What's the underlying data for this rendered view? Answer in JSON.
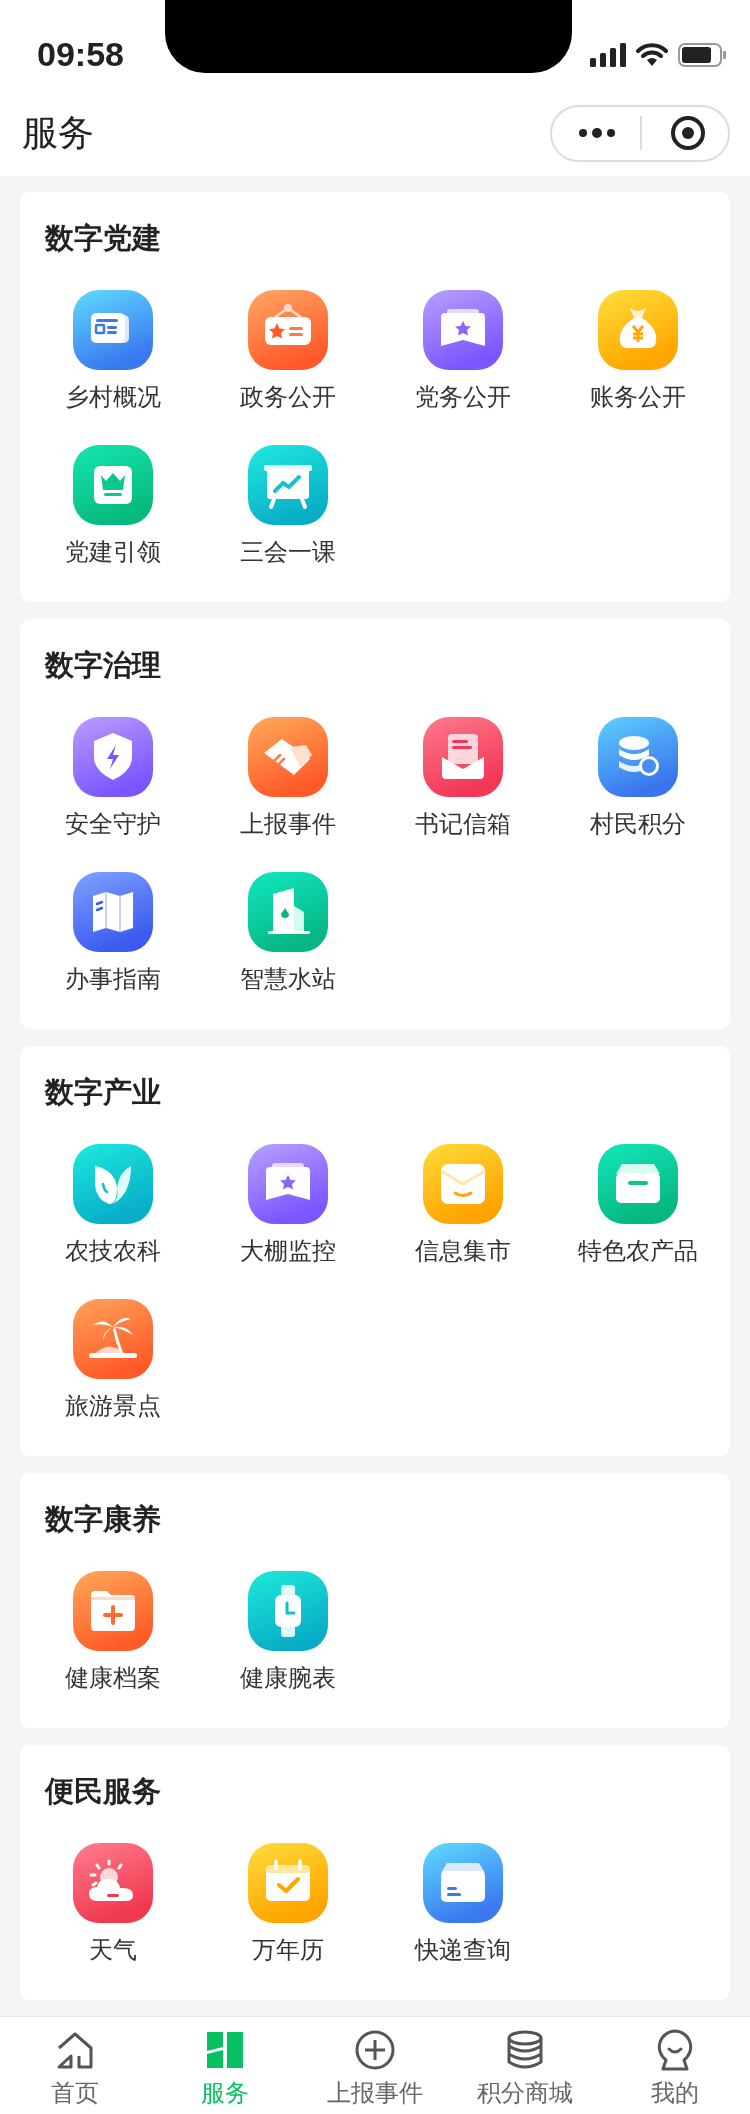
{
  "status_bar": {
    "time": "09:58"
  },
  "header": {
    "title": "服务"
  },
  "sections": [
    {
      "title": "数字党建",
      "items": [
        {
          "label": "乡村概况"
        },
        {
          "label": "政务公开"
        },
        {
          "label": "党务公开"
        },
        {
          "label": "账务公开"
        },
        {
          "label": "党建引领"
        },
        {
          "label": "三会一课"
        }
      ]
    },
    {
      "title": "数字治理",
      "items": [
        {
          "label": "安全守护"
        },
        {
          "label": "上报事件"
        },
        {
          "label": "书记信箱"
        },
        {
          "label": "村民积分"
        },
        {
          "label": "办事指南"
        },
        {
          "label": "智慧水站"
        }
      ]
    },
    {
      "title": "数字产业",
      "items": [
        {
          "label": "农技农科"
        },
        {
          "label": "大棚监控"
        },
        {
          "label": "信息集市"
        },
        {
          "label": "特色农产品"
        },
        {
          "label": "旅游景点"
        }
      ]
    },
    {
      "title": "数字康养",
      "items": [
        {
          "label": "健康档案"
        },
        {
          "label": "健康腕表"
        }
      ]
    },
    {
      "title": "便民服务",
      "items": [
        {
          "label": "天气"
        },
        {
          "label": "万年历"
        },
        {
          "label": "快递查询"
        }
      ]
    }
  ],
  "tab_bar": [
    {
      "label": "首页",
      "selected": false
    },
    {
      "label": "服务",
      "selected": true
    },
    {
      "label": "上报事件",
      "selected": false
    },
    {
      "label": "积分商城",
      "selected": false
    },
    {
      "label": "我的",
      "selected": false
    }
  ]
}
